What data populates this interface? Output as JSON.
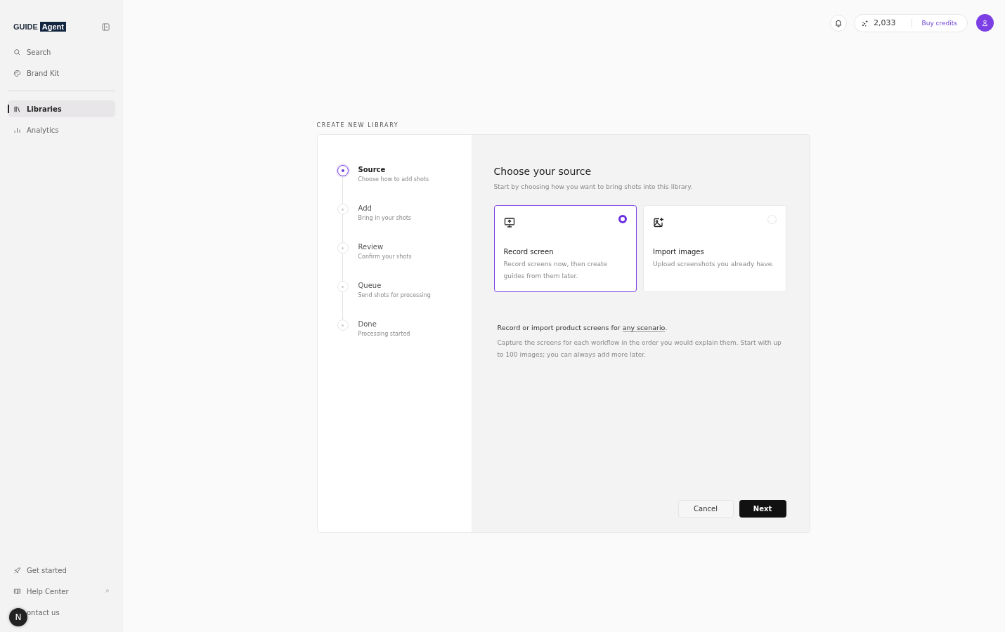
{
  "sidebar": {
    "logo": {
      "word": "GUIDE",
      "badge": "Agent"
    },
    "top_items": [
      {
        "label": "Search",
        "selected": false
      },
      {
        "label": "Brand Kit",
        "selected": false
      }
    ],
    "main_items": [
      {
        "label": "Libraries",
        "selected": true
      },
      {
        "label": "Analytics",
        "selected": false
      }
    ],
    "bottom_items": [
      {
        "label": "Get started",
        "external": false
      },
      {
        "label": "Help Center",
        "external": true
      },
      {
        "label": "ontact us",
        "external": false
      }
    ],
    "dev_badge": "N"
  },
  "header": {
    "credits": "2,033",
    "buy_label": "Buy credits"
  },
  "page_title": "CREATE NEW LIBRARY",
  "steps": [
    {
      "title": "Source",
      "subtitle": "Choose how to add shots",
      "selected": true
    },
    {
      "title": "Add",
      "subtitle": "Bring in your shots",
      "selected": false
    },
    {
      "title": "Review",
      "subtitle": "Confirm your shots",
      "selected": false
    },
    {
      "title": "Queue",
      "subtitle": "Send shots for processing",
      "selected": false
    },
    {
      "title": "Done",
      "subtitle": "Processing started",
      "selected": false
    }
  ],
  "heading": "Choose your source",
  "subheading": "Start by choosing how you want to bring shots into this library.",
  "options": [
    {
      "kind": "record",
      "title": "Record screen",
      "description": "Record screens now, then create guides from them later.",
      "selected": true
    },
    {
      "kind": "import",
      "title": "Import images",
      "description": "Upload screenshots you already have.",
      "selected": false
    }
  ],
  "note": {
    "text": "Record or import product screens for ",
    "link": "any scenario",
    "after": "."
  },
  "detail": "Capture the screens for each workflow in the order you would explain them. Start with up to 100 images; you can always add more later.",
  "buttons": {
    "cancel": "Cancel",
    "next": "Next"
  }
}
